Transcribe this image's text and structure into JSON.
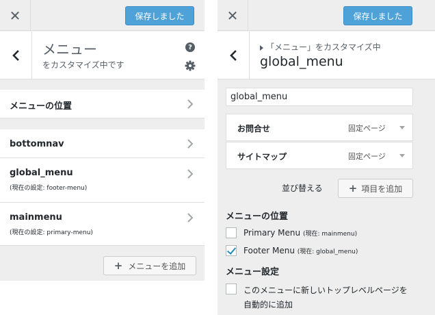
{
  "left": {
    "close": "✕",
    "save_label": "保存しました",
    "title": "メニュー",
    "subtitle": "をカスタマイズ中です",
    "help": "?",
    "location_row": "メニューの位置",
    "menus": [
      {
        "name": "bottomnav",
        "note": ""
      },
      {
        "name": "global_menu",
        "note": "(現在の設定: footer-menu)"
      },
      {
        "name": "mainmenu",
        "note": "(現在の設定: primary-menu)"
      }
    ],
    "add_menu_label": "メニューを追加",
    "plus": "+"
  },
  "right": {
    "close": "✕",
    "save_label": "保存しました",
    "breadcrumb": "「メニュー」をカスタマイズ中",
    "title": "global_menu",
    "menu_name_value": "global_menu",
    "items": [
      {
        "title": "お問合せ",
        "type": "固定ページ"
      },
      {
        "title": "サイトマップ",
        "type": "固定ページ"
      }
    ],
    "reorder_label": "並び替える",
    "add_item_label": "項目を追加",
    "plus": "+",
    "locations_title": "メニューの位置",
    "locations": [
      {
        "label": "Primary Menu",
        "current": "(現在: mainmenu)",
        "checked": false
      },
      {
        "label": "Footer Menu",
        "current": "(現在: global_menu)",
        "checked": true
      }
    ],
    "settings_title": "メニュー設定",
    "auto_add_label": "このメニューに新しいトップレベルページを自動的に追加",
    "auto_add_checked": false
  },
  "colors": {
    "accent": "#4fa2d8",
    "background": "#eeeeee",
    "check": "#1e8cbe"
  }
}
